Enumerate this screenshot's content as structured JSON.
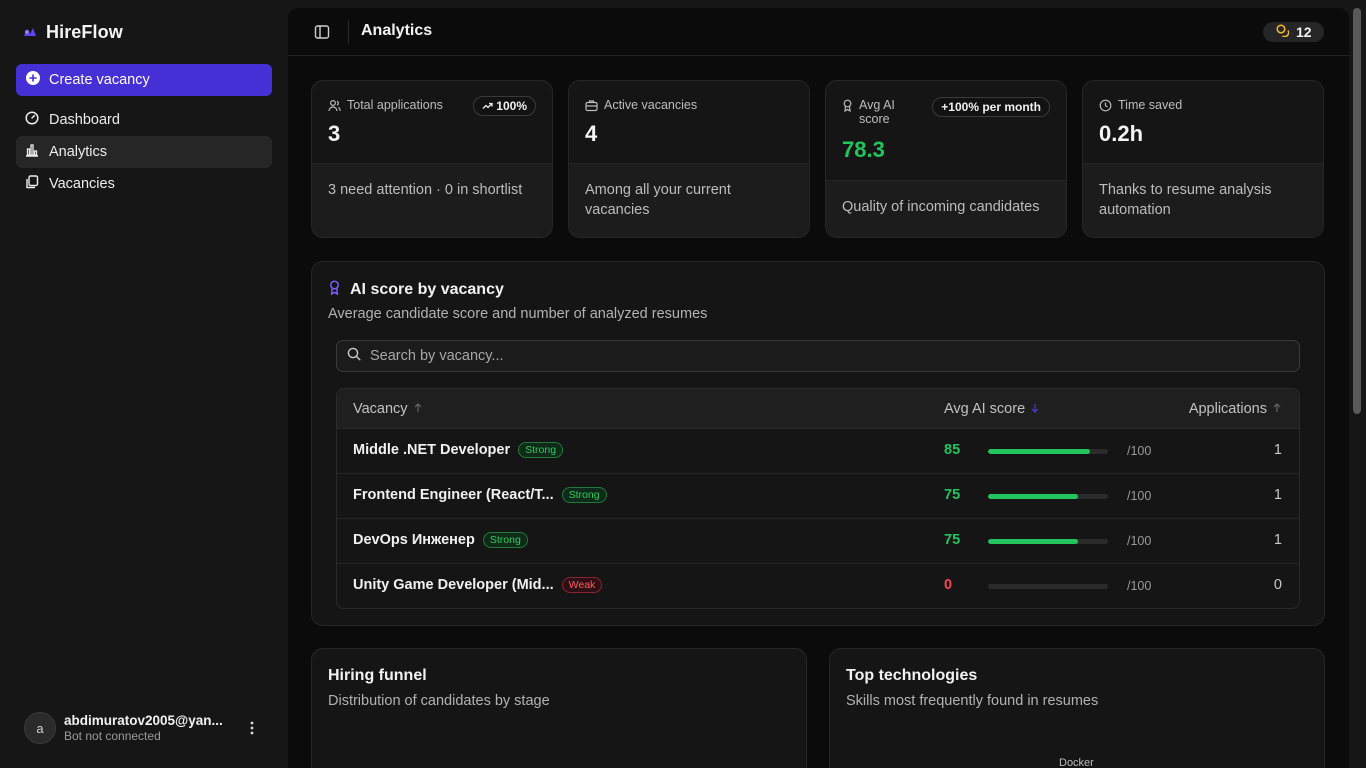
{
  "app": {
    "name": "HireFlow"
  },
  "sidebar": {
    "create_label": "Create vacancy",
    "items": [
      {
        "label": "Dashboard",
        "icon": "dashboard-gauge-icon"
      },
      {
        "label": "Analytics",
        "icon": "bar-chart-icon",
        "active": true
      },
      {
        "label": "Vacancies",
        "icon": "copy-docs-icon"
      }
    ]
  },
  "user": {
    "avatar_letter": "a",
    "email": "abdimuratov2005@yan...",
    "status": "Bot not connected"
  },
  "header": {
    "title": "Analytics",
    "credits": "12"
  },
  "stats": [
    {
      "label": "Total applications",
      "value": "3",
      "badge": "100%",
      "badge_icon": "trend-up-icon",
      "footer": "3 need attention · 0 in shortlist",
      "icon": "users-icon"
    },
    {
      "label": "Active vacancies",
      "value": "4",
      "footer": "Among all your current vacancies",
      "icon": "briefcase-icon"
    },
    {
      "label": "Avg AI score",
      "value": "78.3",
      "badge": "+100% per month",
      "footer": "Quality of incoming candidates",
      "icon": "award-icon"
    },
    {
      "label": "Time saved",
      "value": "0.2h",
      "footer": "Thanks to resume analysis automation",
      "icon": "clock-icon"
    }
  ],
  "score_section": {
    "title": "AI score by vacancy",
    "subtitle": "Average candidate score and number of analyzed resumes",
    "search_placeholder": "Search by vacancy...",
    "columns": {
      "vacancy": "Vacancy",
      "score": "Avg AI score",
      "apps": "Applications"
    },
    "max_label": "/100",
    "rows": [
      {
        "name": "Middle .NET Developer",
        "tag": "Strong",
        "score": "85",
        "score_value": 85,
        "apps": "1"
      },
      {
        "name": "Frontend Engineer (React/T...",
        "tag": "Strong",
        "score": "75",
        "score_value": 75,
        "apps": "1"
      },
      {
        "name": "DevOps Инженер",
        "tag": "Strong",
        "score": "75",
        "score_value": 75,
        "apps": "1"
      },
      {
        "name": "Unity Game Developer (Mid...",
        "tag": "Weak",
        "score": "0",
        "score_value": 0,
        "apps": "0"
      }
    ]
  },
  "funnel": {
    "title": "Hiring funnel",
    "subtitle": "Distribution of candidates by stage"
  },
  "technologies": {
    "title": "Top technologies",
    "subtitle": "Skills most frequently found in resumes",
    "first_label": "Docker"
  },
  "colors": {
    "accent": "#4530d6",
    "good": "#21c45d",
    "bad": "#f04650",
    "background": "#0b0b0b"
  }
}
